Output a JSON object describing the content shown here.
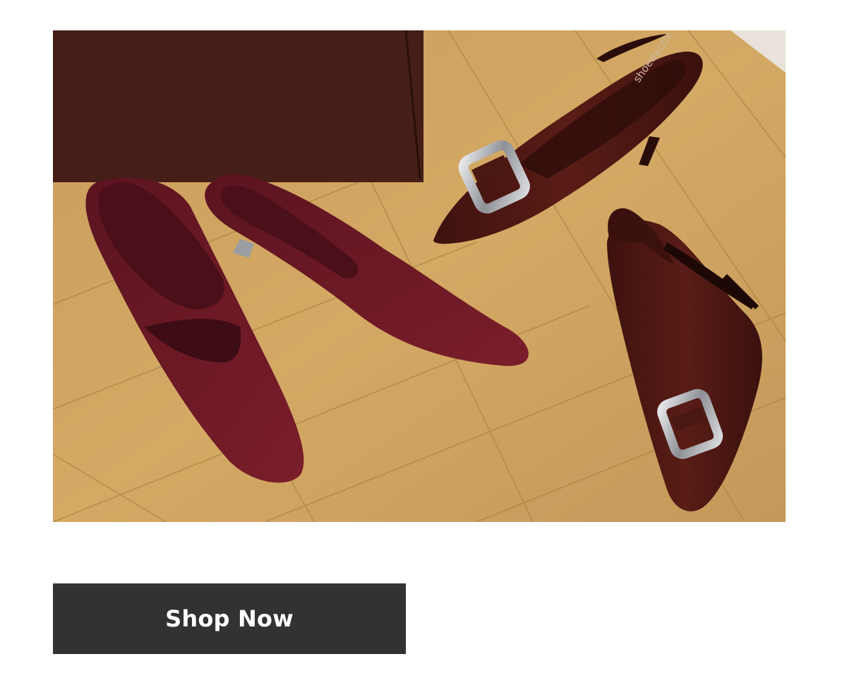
{
  "hero": {
    "image_alt": "Burgundy suede pointed-toe mules and brown patent slingback heels with silver buckles on a wooden floor",
    "brand_imprint": "shoedazzle",
    "colors": {
      "floor": "#c89e5e",
      "suede": "#6e1a24",
      "patent": "#4a1812",
      "bag": "#3c1a14",
      "buckle": "#b9bcc0"
    }
  },
  "cta": {
    "label": "Shop Now",
    "background": "#323232",
    "text_color": "#ffffff"
  }
}
